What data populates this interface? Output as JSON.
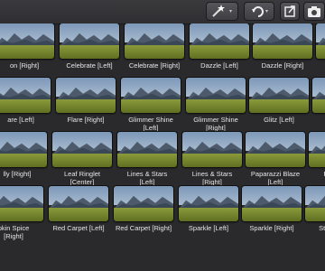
{
  "toolbar": {
    "icons": [
      "magic-wand-icon",
      "rotate-icon",
      "share-icon",
      "camera-icon"
    ]
  },
  "effects": [
    {
      "row": 0,
      "col": 0,
      "label": "Bloom [Right]",
      "show": "Bloom [Right]"
    },
    {
      "row": 0,
      "col": 1,
      "label": "Celebrate [Left]",
      "overlay": "CELEBRATE"
    },
    {
      "row": 0,
      "col": 2,
      "label": "Celebrate [Right]"
    },
    {
      "row": 0,
      "col": 3,
      "label": "Dazzle [Left]",
      "overlay": "DAZZLE"
    },
    {
      "row": 0,
      "col": 4,
      "label": "Dazzle [Right]",
      "overlay": "DAZZLE"
    },
    {
      "row": 0,
      "col": 5,
      "label": "Divine C [Right]"
    },
    {
      "row": 1,
      "col": 0,
      "label": "Flare [Left]"
    },
    {
      "row": 1,
      "col": 1,
      "label": "Flare [Right]",
      "overlay": "FLARE"
    },
    {
      "row": 1,
      "col": 2,
      "label": "Glimmer Shine [Left]"
    },
    {
      "row": 1,
      "col": 3,
      "label": "Glimmer Shine [Right]"
    },
    {
      "row": 1,
      "col": 4,
      "label": "Glitz [Left]"
    },
    {
      "row": 1,
      "col": 5,
      "label": "Glitz [Right]"
    },
    {
      "row": 2,
      "col": 0,
      "label": "Jolly [Right]"
    },
    {
      "row": 2,
      "col": 1,
      "label": "Leaf Ringlet [Center]"
    },
    {
      "row": 2,
      "col": 2,
      "label": "Lines & Stars [Left]"
    },
    {
      "row": 2,
      "col": 3,
      "label": "Lines & Stars [Right]"
    },
    {
      "row": 2,
      "col": 4,
      "label": "Paparazzi Blaze [Left]"
    },
    {
      "row": 2,
      "col": 5,
      "label": "Paparazzi [Right]"
    },
    {
      "row": 3,
      "col": 0,
      "label": "Pumpkin Spice [Right]"
    },
    {
      "row": 3,
      "col": 1,
      "label": "Red Carpet [Left]"
    },
    {
      "row": 3,
      "col": 2,
      "label": "Red Carpet [Right]"
    },
    {
      "row": 3,
      "col": 3,
      "label": "Sparkle [Left]"
    },
    {
      "row": 3,
      "col": 4,
      "label": "Sparkle [Right]"
    },
    {
      "row": 3,
      "col": 5,
      "label": "Stage Light"
    }
  ],
  "visible_labels": [
    [
      "on [Right]",
      "Celebrate [Left]",
      "Celebrate [Right]",
      "Dazzle [Left]",
      "Dazzle [Right]",
      "Divine C\n[Righ"
    ],
    [
      "are [Left]",
      "Flare [Right]",
      "Glimmer Shine\n[Left]",
      "Glimmer Shine\n[Right]",
      "Glitz [Left]",
      "Glitz [R"
    ],
    [
      "lly [Right]",
      "Leaf Ringlet\n[Center]",
      "Lines & Stars\n[Left]",
      "Lines & Stars\n[Right]",
      "Paparazzi Blaze\n[Left]",
      "Paparazzi\n[Righ"
    ],
    [
      "pkin Spice\n[Right]",
      "Red Carpet [Left]",
      "Red Carpet [Right]",
      "Sparkle [Left]",
      "Sparkle [Right]",
      "Stage Ligh"
    ]
  ]
}
